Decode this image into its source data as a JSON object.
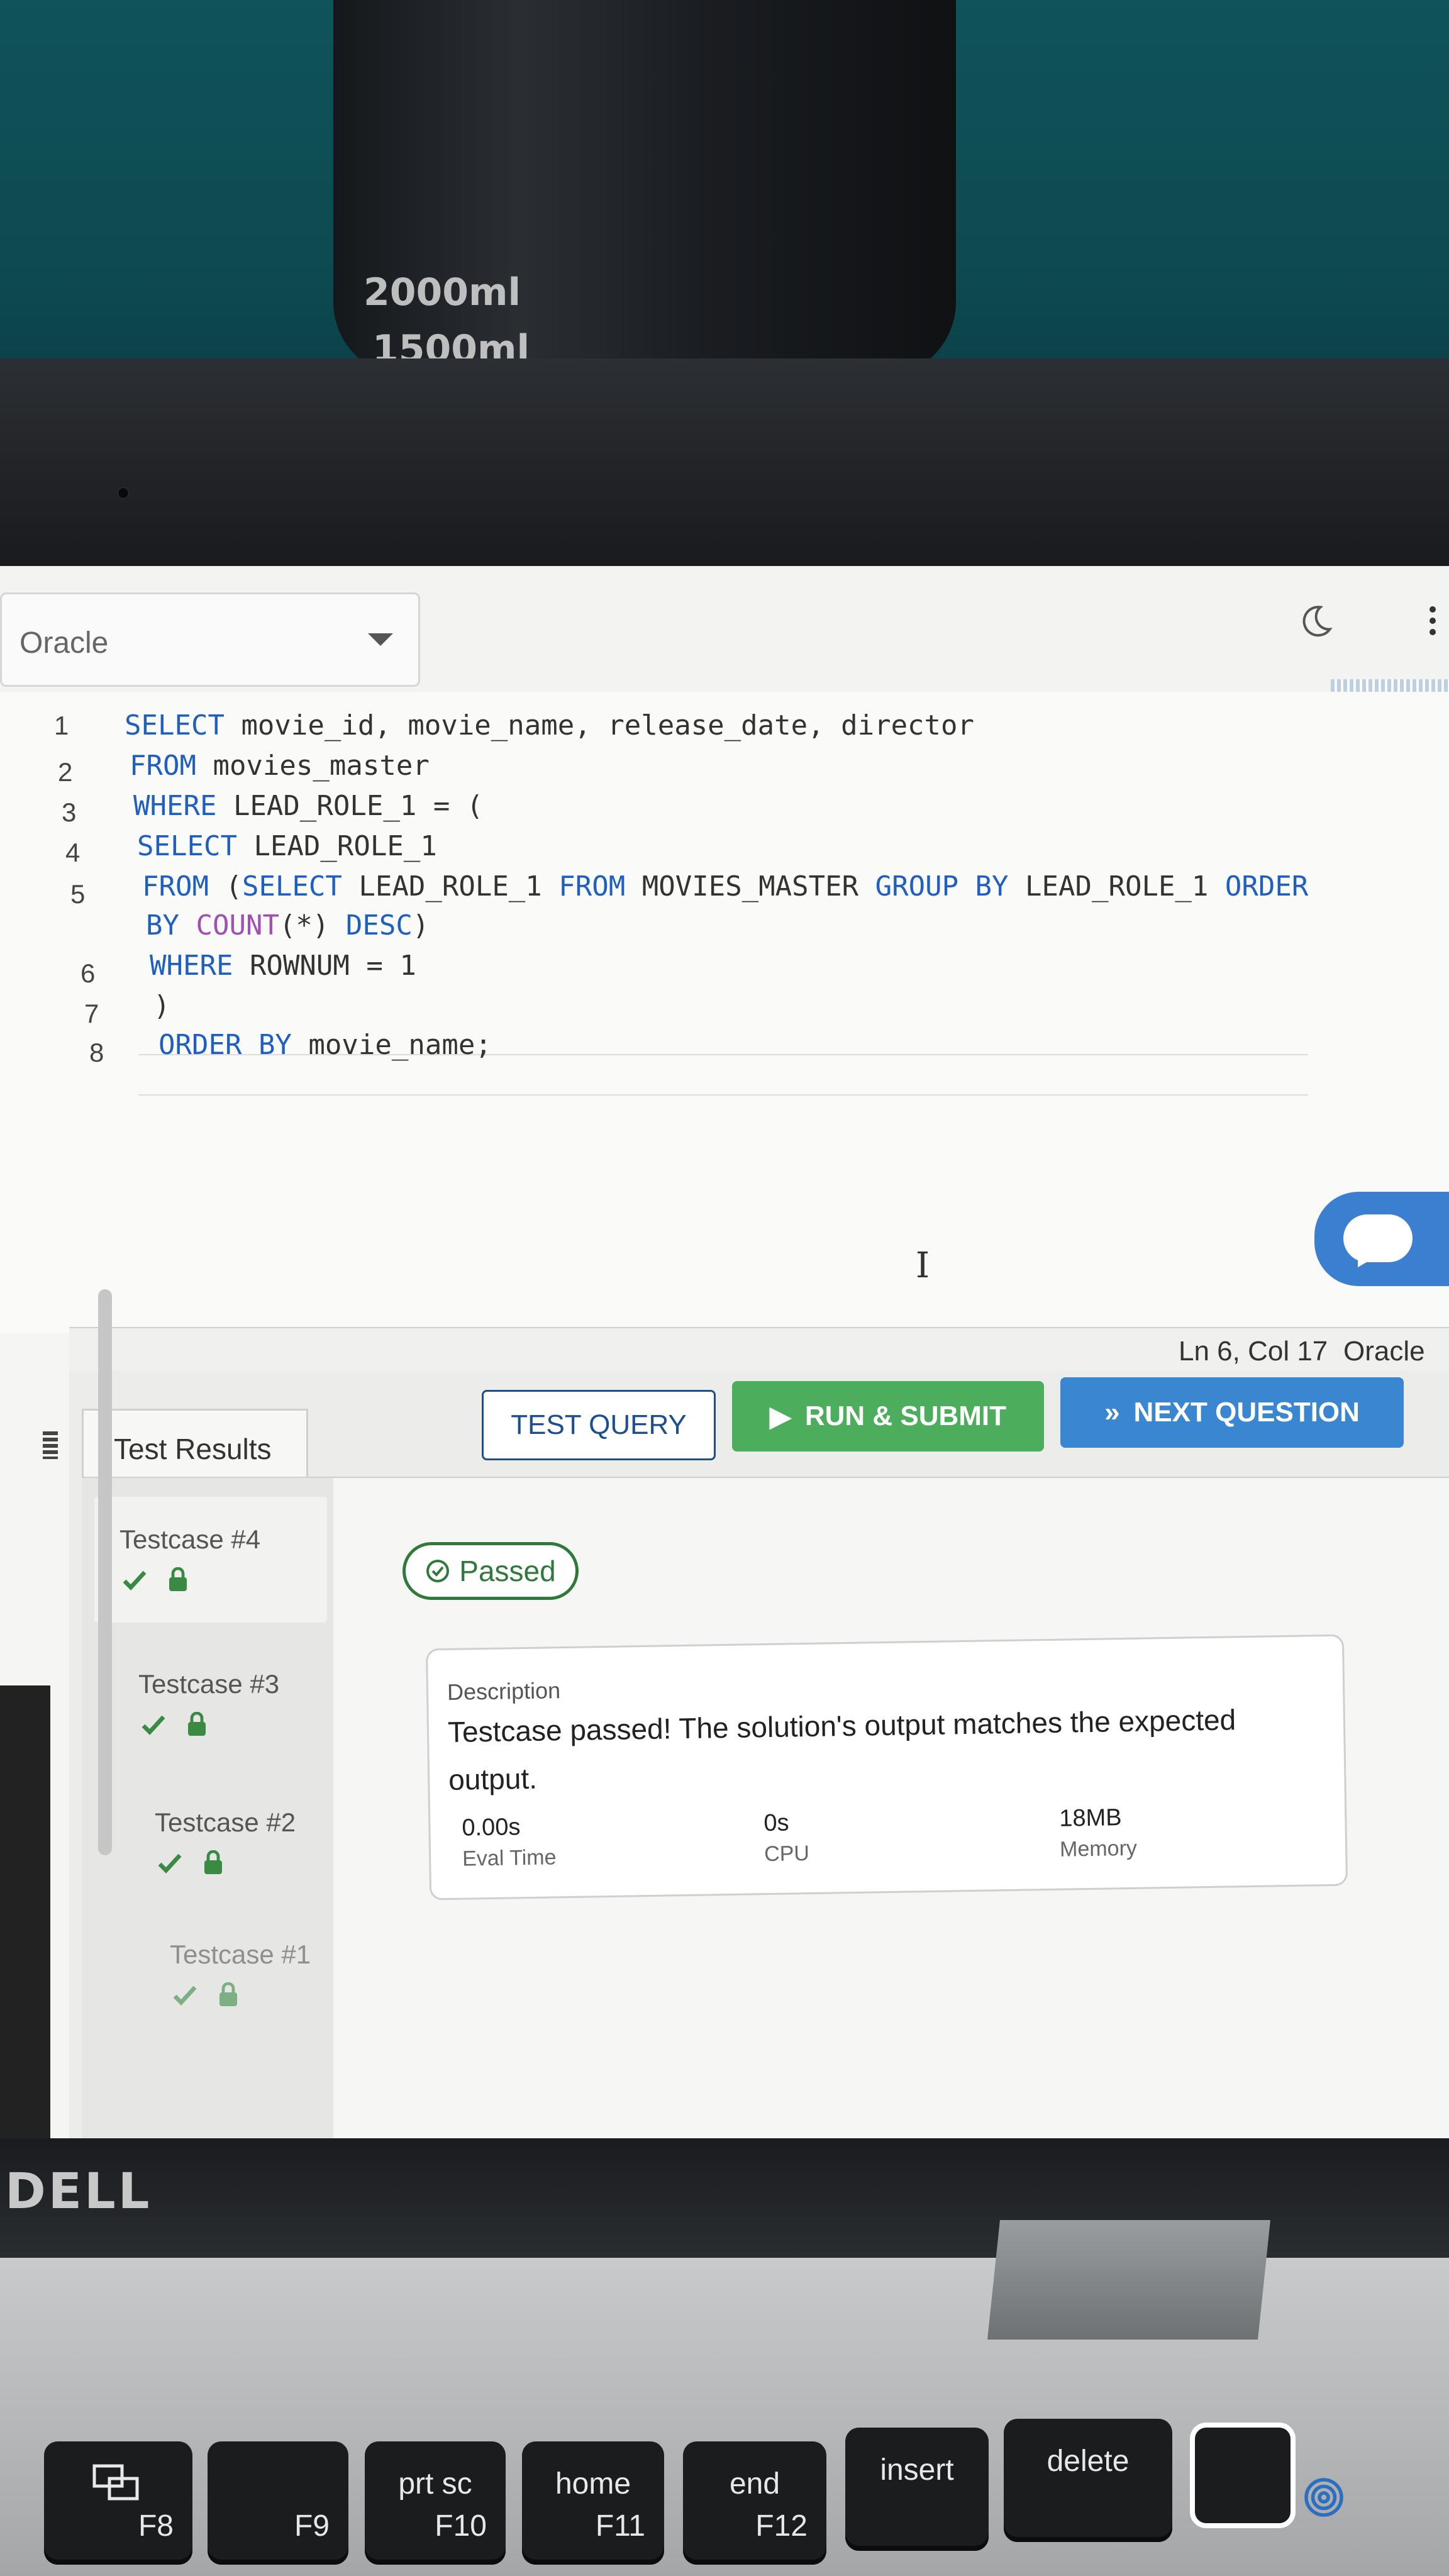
{
  "background": {
    "bottle_marks": [
      "2000ml",
      "1500ml"
    ]
  },
  "toolbar": {
    "db_select_value": "Oracle",
    "moon_icon": "moon-icon",
    "more_icon": "more-vertical-icon"
  },
  "editor": {
    "line_numbers": [
      "1",
      "2",
      "3",
      "4",
      "5",
      "6",
      "7",
      "8"
    ],
    "lines": [
      {
        "tokens": [
          {
            "t": "SELECT",
            "k": "kw"
          },
          {
            "t": " movie_id, movie_name, release_date, director",
            "k": ""
          }
        ]
      },
      {
        "tokens": [
          {
            "t": "FROM",
            "k": "kw"
          },
          {
            "t": " movies_master",
            "k": ""
          }
        ]
      },
      {
        "tokens": [
          {
            "t": "WHERE",
            "k": "kw"
          },
          {
            "t": " LEAD_ROLE_1 = (",
            "k": ""
          }
        ]
      },
      {
        "tokens": [
          {
            "t": "SELECT",
            "k": "kw"
          },
          {
            "t": " LEAD_ROLE_1",
            "k": ""
          }
        ]
      },
      {
        "tokens": [
          {
            "t": "FROM",
            "k": "kw"
          },
          {
            "t": " (",
            "k": ""
          },
          {
            "t": "SELECT",
            "k": "kw"
          },
          {
            "t": " LEAD_ROLE_1 ",
            "k": ""
          },
          {
            "t": "FROM",
            "k": "kw"
          },
          {
            "t": " MOVIES_MASTER ",
            "k": ""
          },
          {
            "t": "GROUP BY",
            "k": "kw"
          },
          {
            "t": " LEAD_ROLE_1 ",
            "k": ""
          },
          {
            "t": "ORDER",
            "k": "kw"
          }
        ]
      },
      {
        "tokens": [
          {
            "t": "BY",
            "k": "kw"
          },
          {
            "t": " ",
            "k": ""
          },
          {
            "t": "COUNT",
            "k": "fn"
          },
          {
            "t": "(*) ",
            "k": ""
          },
          {
            "t": "DESC",
            "k": "kw"
          },
          {
            "t": ")",
            "k": ""
          }
        ]
      },
      {
        "tokens": [
          {
            "t": "WHERE",
            "k": "kw"
          },
          {
            "t": " ROWNUM = 1",
            "k": ""
          }
        ]
      },
      {
        "tokens": [
          {
            "t": ")",
            "k": ""
          }
        ]
      },
      {
        "tokens": [
          {
            "t": "ORDER BY",
            "k": "kw"
          },
          {
            "t": " movie_name;",
            "k": ""
          }
        ]
      }
    ]
  },
  "status": {
    "position": "Ln 6, Col 17",
    "language": "Oracle"
  },
  "results": {
    "tab_label": "Test Results",
    "test_query_label": "TEST QUERY",
    "run_submit_label": "RUN & SUBMIT",
    "next_question_label": "NEXT QUESTION",
    "testcases": [
      {
        "label": "Testcase #4"
      },
      {
        "label": "Testcase #3"
      },
      {
        "label": "Testcase #2"
      },
      {
        "label": "Testcase #1"
      }
    ],
    "badge": "Passed",
    "description_label": "Description",
    "description_text": "Testcase passed! The solution's output matches the expected output.",
    "metrics": [
      {
        "value": "0.00s",
        "label": "Eval Time"
      },
      {
        "value": "0s",
        "label": "CPU"
      },
      {
        "value": "18MB",
        "label": "Memory"
      }
    ]
  },
  "laptop": {
    "brand": "DELL"
  },
  "keyboard": {
    "keys": [
      {
        "top": "",
        "bottom": "F8"
      },
      {
        "top": "",
        "bottom": "F9"
      },
      {
        "top": "prt sc",
        "bottom": "F10"
      },
      {
        "top": "home",
        "bottom": "F11"
      },
      {
        "top": "end",
        "bottom": "F12"
      },
      {
        "top": "insert",
        "bottom": ""
      },
      {
        "top": "delete",
        "bottom": ""
      }
    ]
  },
  "colors": {
    "keyword": "#1f5fbf",
    "function": "#a050b5",
    "run_button": "#4cae5c",
    "next_button": "#3a86d1",
    "passed": "#2f7a3a"
  }
}
